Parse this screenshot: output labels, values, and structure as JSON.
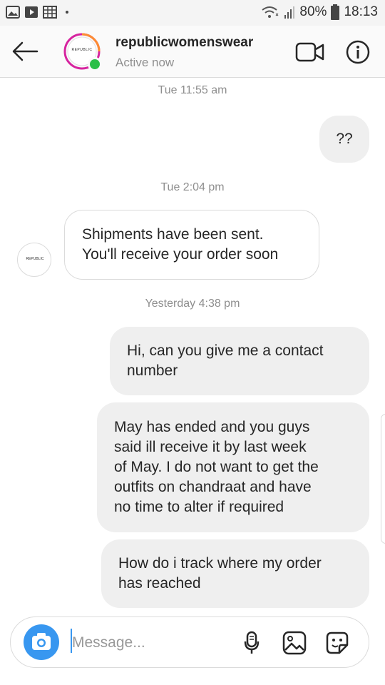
{
  "status_bar": {
    "battery": "80%",
    "time": "18:13"
  },
  "header": {
    "username": "republicwomenswear",
    "status": "Active now",
    "avatar_text": "REPUBLIC"
  },
  "messages": [
    {
      "kind": "timestamp",
      "text": "Tue 11:55 am"
    },
    {
      "kind": "outgoing",
      "text": "??"
    },
    {
      "kind": "timestamp",
      "text": "Tue 2:04 pm"
    },
    {
      "kind": "incoming",
      "lines": [
        "Shipments have been sent.",
        "You'll receive your order soon"
      ]
    },
    {
      "kind": "timestamp",
      "text": "Yesterday 4:38 pm"
    },
    {
      "kind": "outgoing",
      "lines": [
        "Hi, can you give me a contact",
        "number"
      ]
    },
    {
      "kind": "outgoing",
      "lines": [
        "May has ended and you guys",
        "said ill receive it by last week",
        "of May. I do not want to get the",
        "outfits on chandraat and have",
        "no time to alter if required"
      ]
    },
    {
      "kind": "outgoing",
      "lines": [
        "How do i track where my order",
        "has reached"
      ]
    }
  ],
  "composer": {
    "placeholder": "Message..."
  },
  "icons": {
    "back": "back-arrow-icon",
    "video": "video-call-icon",
    "info": "info-icon",
    "camera": "camera-icon",
    "mic": "microphone-icon",
    "gallery": "gallery-icon",
    "sticker": "sticker-icon"
  },
  "colors": {
    "accent": "#3897f0",
    "online": "#2bbf48",
    "bubble_out": "#efefef"
  }
}
